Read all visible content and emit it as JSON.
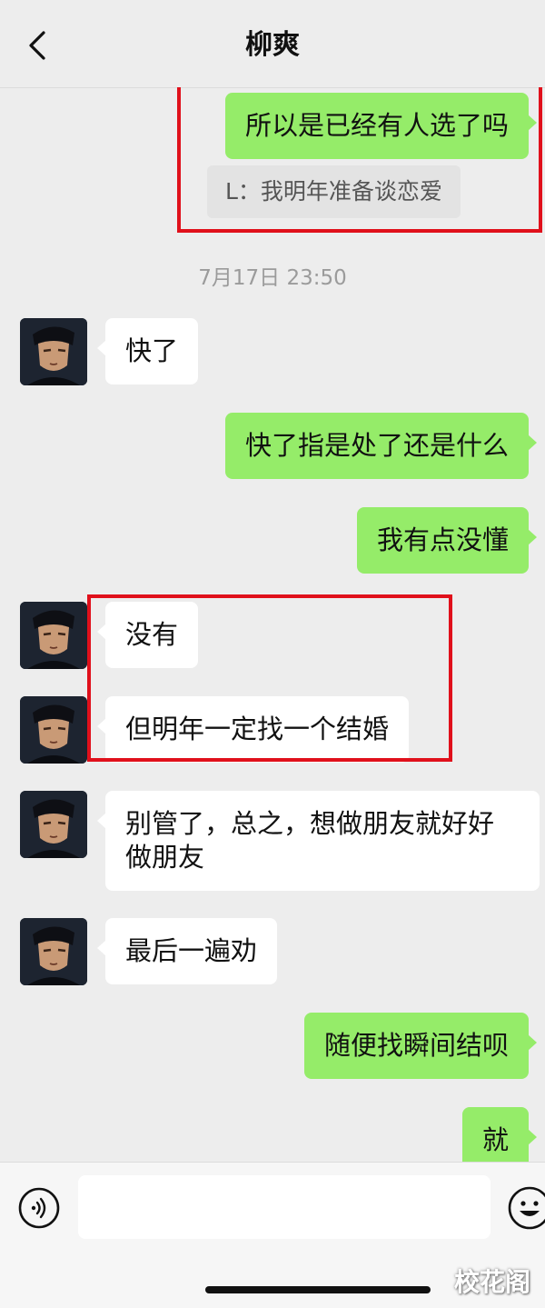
{
  "header": {
    "title": "柳爽"
  },
  "messages": [
    {
      "id": "m1",
      "side": "me",
      "text": "所以是已经有人选了吗",
      "quote": "L：我明年准备谈恋爱"
    },
    {
      "id": "t1",
      "type": "time",
      "text": "7月17日 23:50"
    },
    {
      "id": "m2",
      "side": "them",
      "text": "快了"
    },
    {
      "id": "m3",
      "side": "me",
      "text": "快了指是处了还是什么"
    },
    {
      "id": "m4",
      "side": "me",
      "text": "我有点没懂"
    },
    {
      "id": "m5",
      "side": "them",
      "text": "没有"
    },
    {
      "id": "m6",
      "side": "them",
      "text": "但明年一定找一个结婚"
    },
    {
      "id": "m7",
      "side": "them",
      "text": "别管了，总之，想做朋友就好好做朋友"
    },
    {
      "id": "m8",
      "side": "them",
      "text": "最后一遍劝"
    },
    {
      "id": "m9",
      "side": "me",
      "text": "随便找瞬间结呗"
    },
    {
      "id": "m10",
      "side": "me",
      "text": "就"
    }
  ],
  "input": {
    "value": ""
  },
  "watermark": "校花阁",
  "colors": {
    "my_bubble": "#95ec69",
    "their_bubble": "#ffffff",
    "highlight_box": "#e0101b",
    "background": "#ededed"
  },
  "icons": {
    "back": "chevron-left-icon",
    "voice": "voice-icon",
    "emoji": "emoji-icon"
  }
}
